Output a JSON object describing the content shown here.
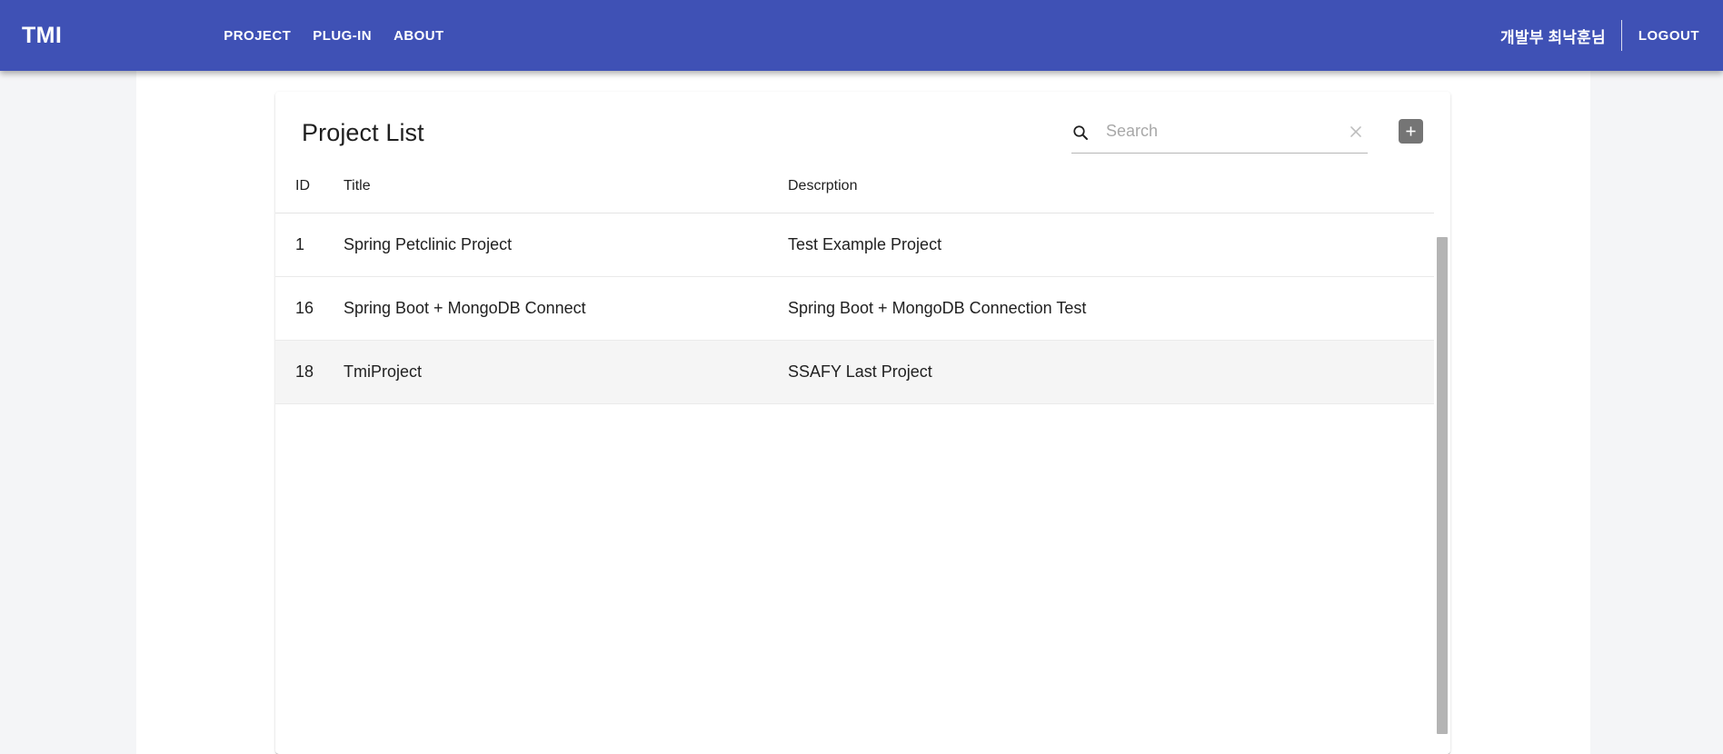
{
  "navbar": {
    "brand": "TMI",
    "links": [
      {
        "label": "PROJECT",
        "name": "nav-link-project"
      },
      {
        "label": "PLUG-IN",
        "name": "nav-link-plugin"
      },
      {
        "label": "ABOUT",
        "name": "nav-link-about"
      }
    ],
    "user_name": "개발부 최낙훈님",
    "logout_label": "LOGOUT",
    "background_color": "#3f51b5",
    "text_color": "#ffffff"
  },
  "card": {
    "title": "Project List",
    "search": {
      "value": "",
      "placeholder": "Search",
      "search_icon": "search-icon",
      "clear_icon": "close-icon"
    },
    "add_button": {
      "icon": "plus-icon",
      "label": "+",
      "background_color": "#757575"
    }
  },
  "table": {
    "columns": [
      {
        "key": "id",
        "label": "ID"
      },
      {
        "key": "title",
        "label": "Title"
      },
      {
        "key": "desc",
        "label": "Descrption"
      }
    ],
    "rows": [
      {
        "id": "1",
        "title": "Spring Petclinic Project",
        "desc": "Test Example Project",
        "selected": false
      },
      {
        "id": "16",
        "title": "Spring Boot + MongoDB Connect",
        "desc": "Spring Boot + MongoDB Connection Test",
        "selected": false
      },
      {
        "id": "18",
        "title": "TmiProject",
        "desc": "SSAFY Last Project",
        "selected": true
      }
    ],
    "selected_row_color": "#f5f5f5"
  },
  "scrollbar": {
    "thumb_color": "#b4b4b4"
  },
  "colors": {
    "page_background": "#f4f5f7",
    "sheet_background": "#ffffff",
    "card_background": "#ffffff",
    "accent": "#3f51b5"
  }
}
